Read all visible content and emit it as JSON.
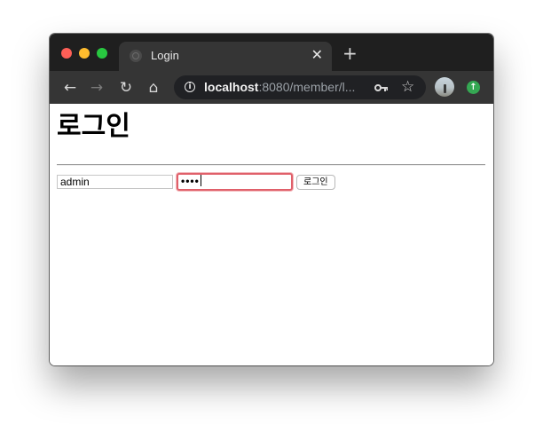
{
  "browser": {
    "tab": {
      "title": "Login",
      "close_glyph": "✕"
    },
    "new_tab_glyph": "+",
    "nav": {
      "back_glyph": "←",
      "forward_glyph": "→",
      "reload_glyph": "↻",
      "home_glyph": "⌂"
    },
    "address_bar": {
      "info_glyph": "i",
      "host": "localhost",
      "path": ":8080/member/l..."
    },
    "bookmark_glyph": "☆",
    "update_glyph": "↑"
  },
  "page": {
    "title": "로그인",
    "form": {
      "username_value": "admin",
      "password_masked": "••••",
      "submit_label": "로그인"
    }
  },
  "colors": {
    "titlebar": "#1f1f1f",
    "toolbar": "#353535",
    "focus_ring": "#e0606a",
    "close": "#fe5f57",
    "minimize": "#febc2e",
    "maximize": "#28c840"
  },
  "icons": {
    "password_manager": "key-icon",
    "bookmark": "star-icon",
    "profile": "avatar",
    "update": "arrow-up-icon"
  }
}
